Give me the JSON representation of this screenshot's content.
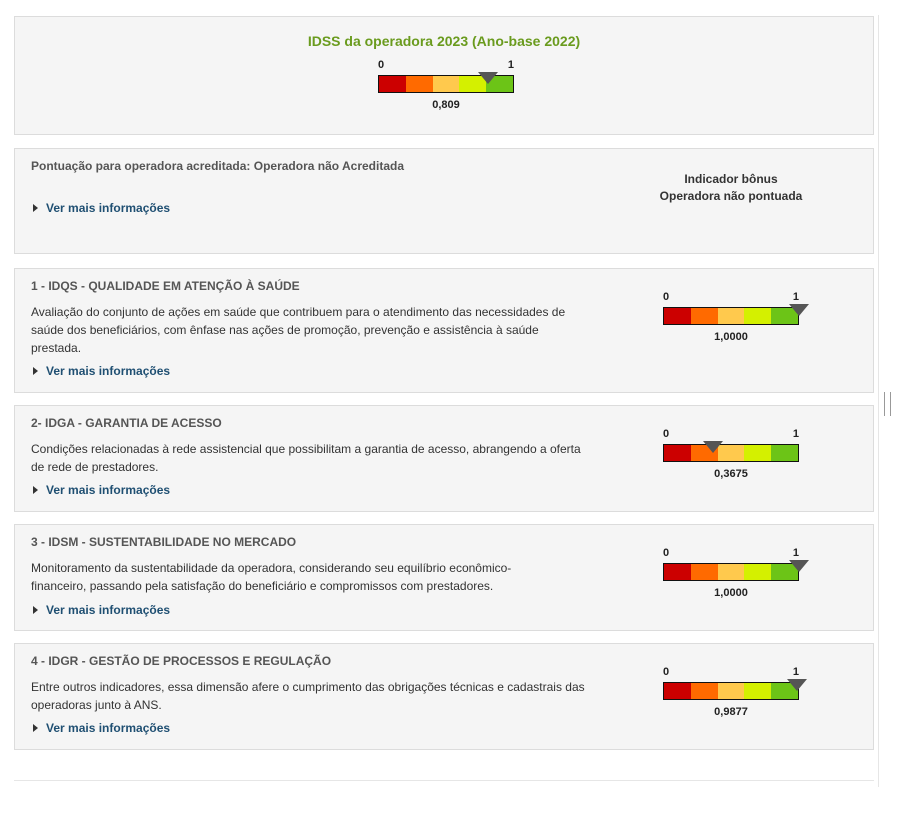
{
  "idss": {
    "title": "IDSS da operadora 2023 (Ano-base 2022)",
    "min": "0",
    "max": "1",
    "value_label": "0,809",
    "value": 0.809
  },
  "accreditation": {
    "text": "Pontuação para operadora acreditada: Operadora não Acreditada",
    "more_label": "Ver mais informações",
    "bonus_title": "Indicador bônus",
    "bonus_value": "Operadora não pontuada"
  },
  "sections": [
    {
      "title": "1 - IDQS - QUALIDADE EM ATENÇÃO À SAÚDE",
      "description": "Avaliação do conjunto de ações em saúde que contribuem para o atendimento das necessidades de saúde dos beneficiários, com ênfase nas ações de promoção, prevenção e assistência à saúde prestada.",
      "more_label": "Ver mais informações",
      "min": "0",
      "max": "1",
      "value_label": "1,0000",
      "value": 1.0
    },
    {
      "title": "2- IDGA - GARANTIA DE ACESSO",
      "description": "Condições relacionadas à rede assistencial que possibilitam a garantia de acesso, abrangendo a oferta de rede de prestadores.",
      "more_label": "Ver mais informações",
      "min": "0",
      "max": "1",
      "value_label": "0,3675",
      "value": 0.3675
    },
    {
      "title": "3 - IDSM - SUSTENTABILIDADE NO MERCADO",
      "description": "Monitoramento da sustentabilidade da operadora, considerando seu equilíbrio econômico-financeiro, passando pela satisfação do beneficiário e compromissos com prestadores.",
      "more_label": "Ver mais informações",
      "min": "0",
      "max": "1",
      "value_label": "1,0000",
      "value": 1.0
    },
    {
      "title": "4 - IDGR - GESTÃO DE PROCESSOS E REGULAÇÃO",
      "description": "Entre outros indicadores, essa dimensão afere o cumprimento das obrigações técnicas e cadastrais das operadoras junto à ANS.",
      "more_label": "Ver mais informações",
      "min": "0",
      "max": "1",
      "value_label": "0,9877",
      "value": 0.9877
    }
  ],
  "colors": {
    "title_green": "#6a9b1e",
    "link_blue": "#1f4f72",
    "scale": [
      "#cc0000",
      "#ff6a00",
      "#ffc94d",
      "#d4f000",
      "#6cc417"
    ]
  }
}
